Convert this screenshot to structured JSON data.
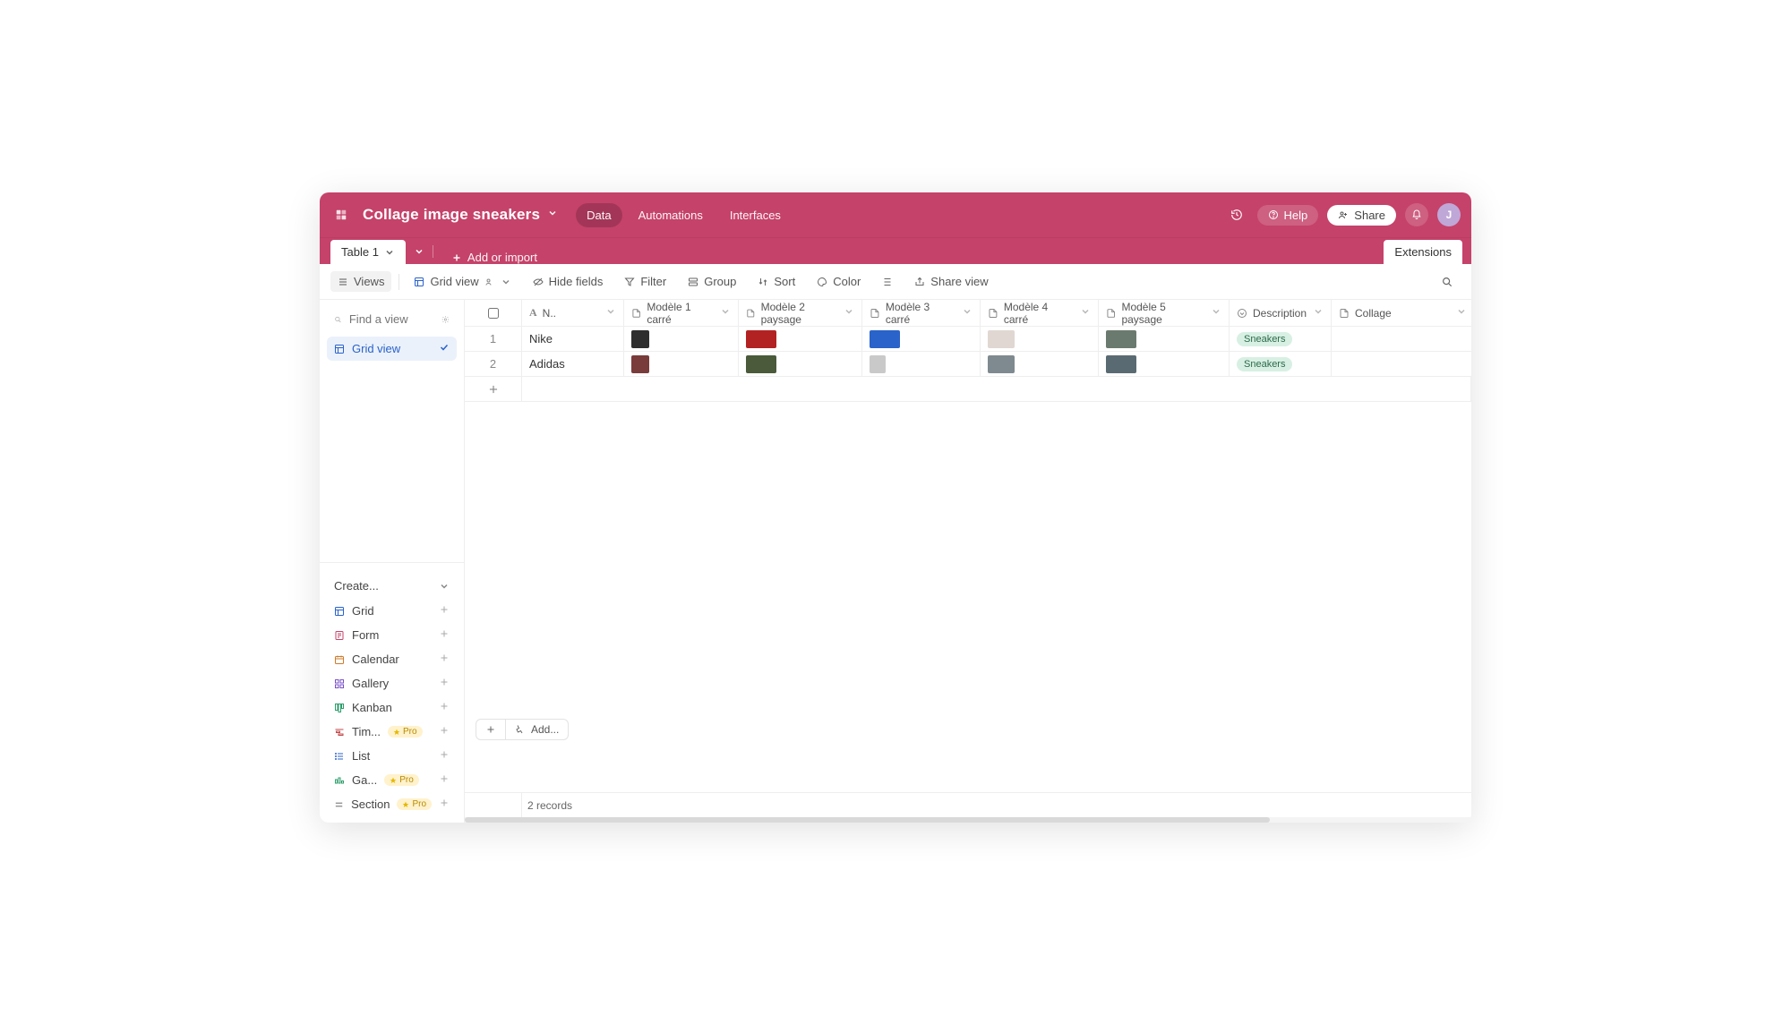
{
  "header": {
    "title": "Collage image sneakers",
    "tabs": [
      "Data",
      "Automations",
      "Interfaces"
    ],
    "active_tab": 0,
    "help_label": "Help",
    "share_label": "Share",
    "avatar_initial": "J"
  },
  "tabs_row": {
    "active_table": "Table 1",
    "add_import_label": "Add or import",
    "extensions_label": "Extensions"
  },
  "toolbar": {
    "views_label": "Views",
    "grid_view_label": "Grid view",
    "hide_fields_label": "Hide fields",
    "filter_label": "Filter",
    "group_label": "Group",
    "sort_label": "Sort",
    "color_label": "Color",
    "share_view_label": "Share view"
  },
  "sidebar": {
    "search_placeholder": "Find a view",
    "active_view": "Grid view",
    "create_header": "Create...",
    "create_items": [
      {
        "label": "Grid",
        "pro": false,
        "color": "#2a62c9"
      },
      {
        "label": "Form",
        "pro": false,
        "color": "#c5426a"
      },
      {
        "label": "Calendar",
        "pro": false,
        "color": "#d07a2a"
      },
      {
        "label": "Gallery",
        "pro": false,
        "color": "#7a4fc7"
      },
      {
        "label": "Kanban",
        "pro": false,
        "color": "#2e9e6b"
      },
      {
        "label": "Tim...",
        "pro": true,
        "color": "#c24848"
      },
      {
        "label": "List",
        "pro": false,
        "color": "#2a62c9"
      },
      {
        "label": "Ga...",
        "pro": true,
        "color": "#2e9e6b"
      },
      {
        "label": "Section",
        "pro": true,
        "color": "#555"
      }
    ],
    "pro_label": "Pro"
  },
  "columns": [
    {
      "type": "num",
      "label": ""
    },
    {
      "type": "text",
      "label": "N.."
    },
    {
      "type": "attachment",
      "label": "Modèle 1 carré"
    },
    {
      "type": "attachment",
      "label": "Modèle 2 paysage"
    },
    {
      "type": "attachment",
      "label": "Modèle 3 carré"
    },
    {
      "type": "attachment",
      "label": "Modèle 4 carré"
    },
    {
      "type": "attachment",
      "label": "Modèle 5 paysage"
    },
    {
      "type": "select",
      "label": "Description"
    },
    {
      "type": "attachment",
      "label": "Collage"
    }
  ],
  "rows": [
    {
      "n": 1,
      "name": "Nike",
      "m1_color": "#2e2e2e",
      "m2_color": "#b32222",
      "m3_color": "#2a63c9",
      "m4_color": "#e0d7d2",
      "m5_color": "#6b7a6e",
      "description": "Sneakers"
    },
    {
      "n": 2,
      "name": "Adidas",
      "m1_color": "#7a3b3b",
      "m2_color": "#4a5a3a",
      "m3_color": "#c9c9c9",
      "m4_color": "#7f8a90",
      "m5_color": "#5a6a72",
      "description": "Sneakers"
    }
  ],
  "footer": {
    "add_label": "Add...",
    "records_label": "2 records"
  }
}
